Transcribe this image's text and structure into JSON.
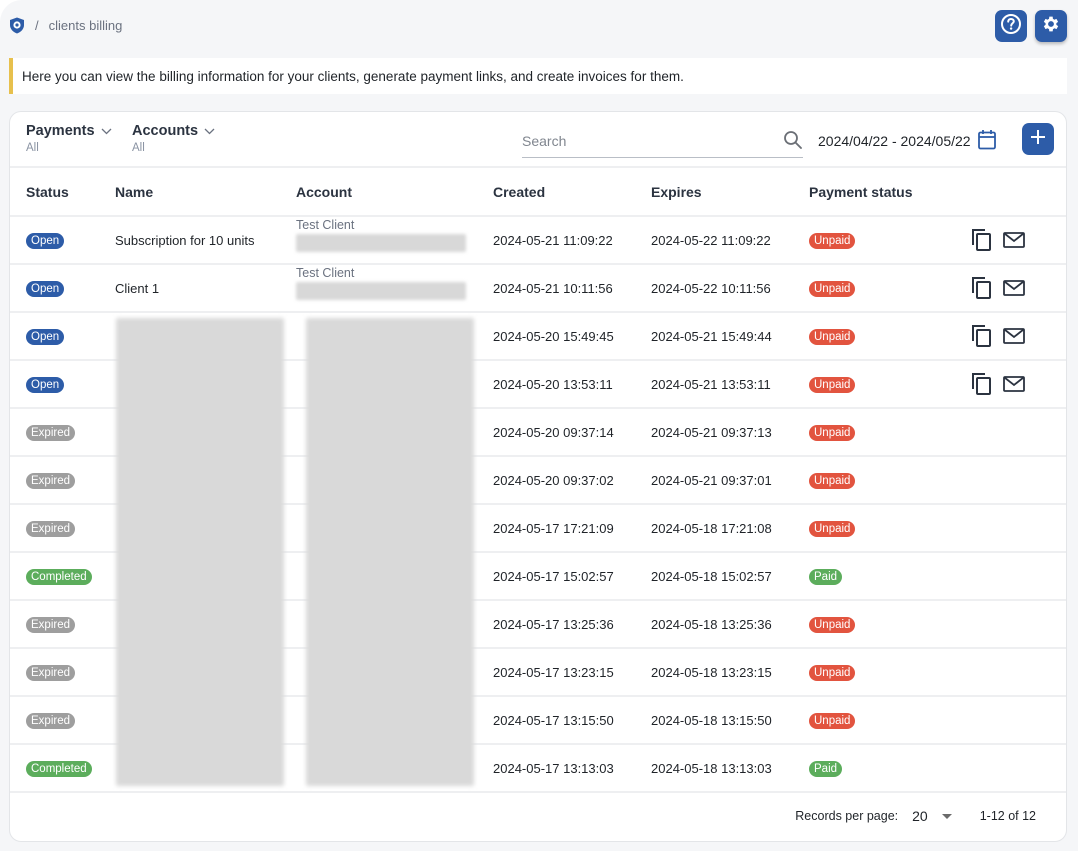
{
  "breadcrumb": {
    "separator": "/",
    "current": "clients billing"
  },
  "header": {
    "help_icon": "help-circle-icon",
    "settings_icon": "gear-icon"
  },
  "info_text": "Here you can view the billing information for your clients, generate payment links, and create invoices for them.",
  "filters": {
    "payments": {
      "label": "Payments",
      "value": "All"
    },
    "accounts": {
      "label": "Accounts",
      "value": "All"
    }
  },
  "search": {
    "placeholder": "Search",
    "value": ""
  },
  "date_range": "2024/04/22 - 2024/05/22",
  "colors": {
    "primary": "#2d5ca8",
    "open": "#2d5ca8",
    "expired": "#9e9e9e",
    "completed": "#5cad5c",
    "unpaid": "#e2543f",
    "paid": "#5cad5c",
    "info_accent": "#e7c04d"
  },
  "table": {
    "columns": [
      "Status",
      "Name",
      "Account",
      "Created",
      "Expires",
      "Payment status"
    ],
    "rows": [
      {
        "status": "Open",
        "name": "Subscription for 10 units",
        "account": "Test Client",
        "created": "2024-05-21 11:09:22",
        "expires": "2024-05-22 11:09:22",
        "payment": "Unpaid",
        "actions": true
      },
      {
        "status": "Open",
        "name": "Client 1",
        "account": "Test Client",
        "created": "2024-05-21 10:11:56",
        "expires": "2024-05-22 10:11:56",
        "payment": "Unpaid",
        "actions": true
      },
      {
        "status": "Open",
        "name": "",
        "account": "",
        "created": "2024-05-20 15:49:45",
        "expires": "2024-05-21 15:49:44",
        "payment": "Unpaid",
        "actions": true
      },
      {
        "status": "Open",
        "name": "",
        "account": "",
        "created": "2024-05-20 13:53:11",
        "expires": "2024-05-21 13:53:11",
        "payment": "Unpaid",
        "actions": true
      },
      {
        "status": "Expired",
        "name": "",
        "account": "",
        "created": "2024-05-20 09:37:14",
        "expires": "2024-05-21 09:37:13",
        "payment": "Unpaid",
        "actions": false
      },
      {
        "status": "Expired",
        "name": "",
        "account": "",
        "created": "2024-05-20 09:37:02",
        "expires": "2024-05-21 09:37:01",
        "payment": "Unpaid",
        "actions": false
      },
      {
        "status": "Expired",
        "name": "",
        "account": "",
        "created": "2024-05-17 17:21:09",
        "expires": "2024-05-18 17:21:08",
        "payment": "Unpaid",
        "actions": false
      },
      {
        "status": "Completed",
        "name": "",
        "account": "",
        "created": "2024-05-17 15:02:57",
        "expires": "2024-05-18 15:02:57",
        "payment": "Paid",
        "actions": false
      },
      {
        "status": "Expired",
        "name": "",
        "account": "",
        "created": "2024-05-17 13:25:36",
        "expires": "2024-05-18 13:25:36",
        "payment": "Unpaid",
        "actions": false
      },
      {
        "status": "Expired",
        "name": "",
        "account": "",
        "created": "2024-05-17 13:23:15",
        "expires": "2024-05-18 13:23:15",
        "payment": "Unpaid",
        "actions": false
      },
      {
        "status": "Expired",
        "name": "",
        "account": "",
        "created": "2024-05-17 13:15:50",
        "expires": "2024-05-18 13:15:50",
        "payment": "Unpaid",
        "actions": false
      },
      {
        "status": "Completed",
        "name": "",
        "account": "",
        "created": "2024-05-17 13:13:03",
        "expires": "2024-05-18 13:13:03",
        "payment": "Paid",
        "actions": false
      }
    ]
  },
  "pagination": {
    "records_per_page_label": "Records per page:",
    "records_per_page": "20",
    "range": "1-12 of 12"
  }
}
